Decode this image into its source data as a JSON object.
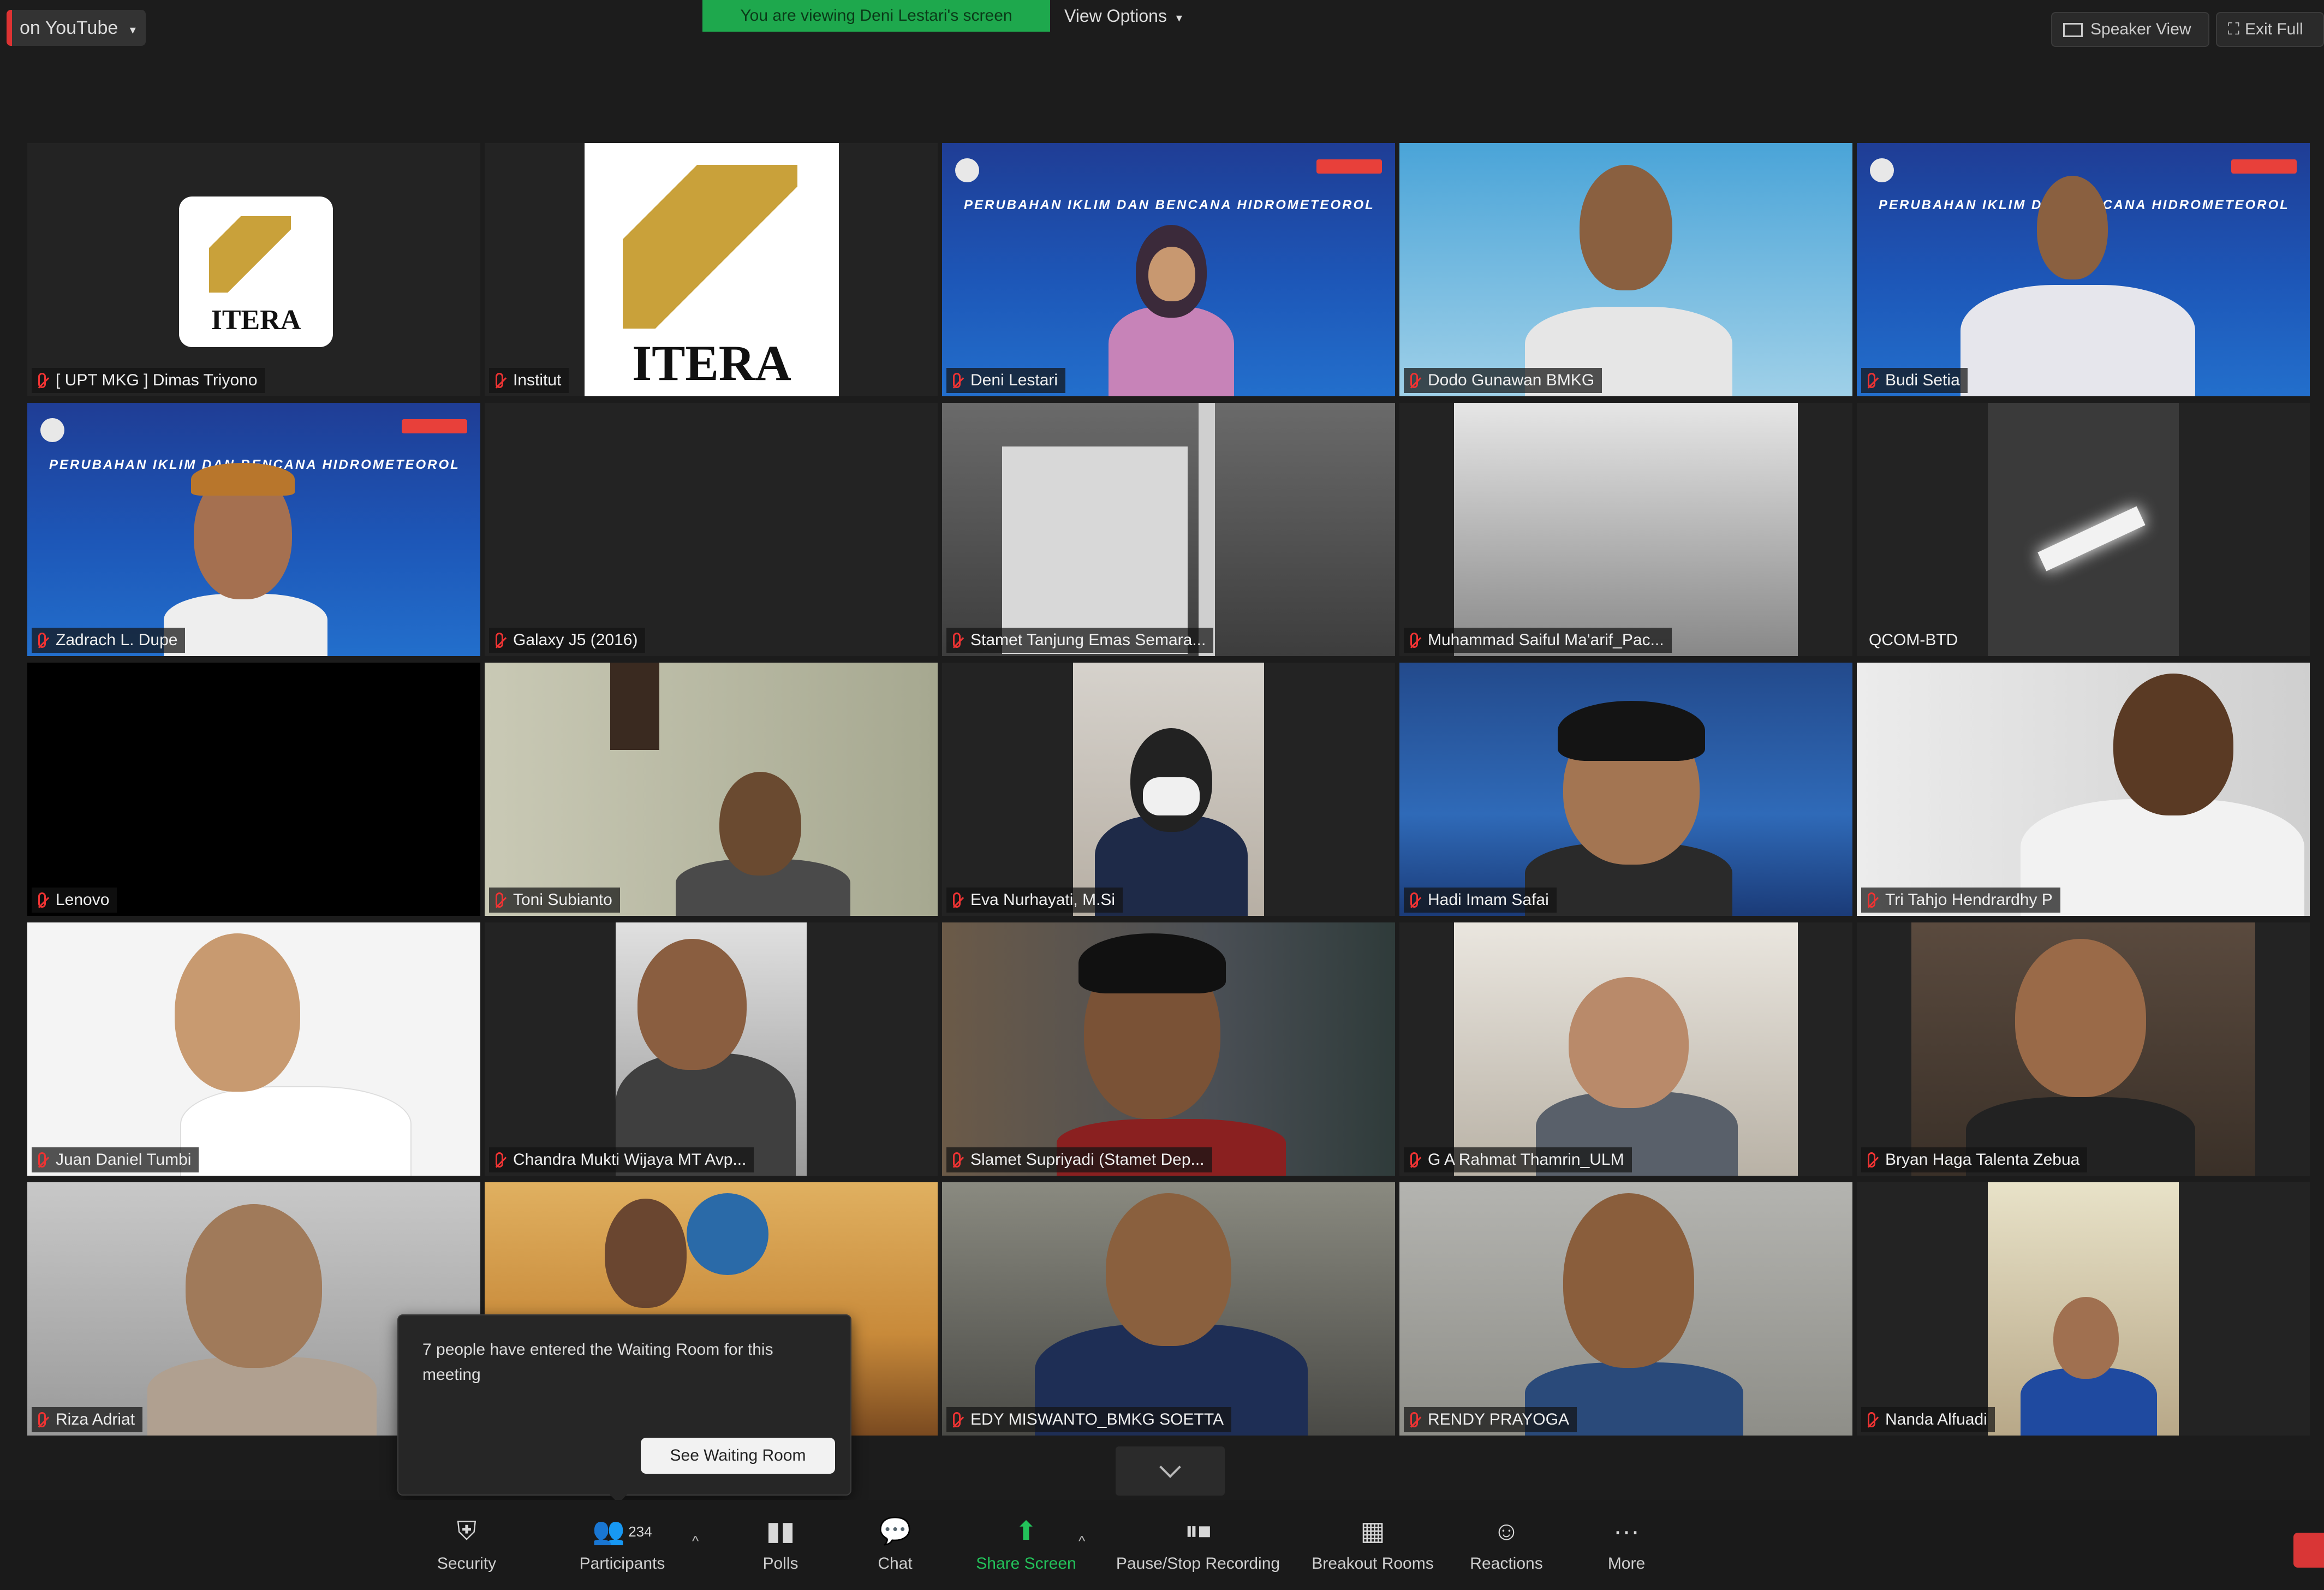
{
  "topbar": {
    "live_label": "on YouTube",
    "viewing_banner": "You are viewing Deni Lestari's screen",
    "view_options": "View Options",
    "speaker_view": "Speaker View",
    "exit_full": "Exit Full"
  },
  "participants": [
    {
      "name": "[ UPT MKG ] Dimas Triyono"
    },
    {
      "name": "Institut"
    },
    {
      "name": "Deni Lestari"
    },
    {
      "name": "Dodo Gunawan BMKG"
    },
    {
      "name": "Budi Setia"
    },
    {
      "name": "Zadrach L. Dupe"
    },
    {
      "name": "Galaxy J5 (2016)"
    },
    {
      "name": "Stamet Tanjung Emas Semara..."
    },
    {
      "name": "Muhammad Saiful Ma'arif_Pac..."
    },
    {
      "name": "QCOM-BTD"
    },
    {
      "name": "Lenovo"
    },
    {
      "name": "Toni Subianto"
    },
    {
      "name": "Eva Nurhayati, M.Si"
    },
    {
      "name": "Hadi Imam Safai"
    },
    {
      "name": "Tri Tahjo Hendrardhy P"
    },
    {
      "name": "Juan Daniel Tumbi"
    },
    {
      "name": "Chandra Mukti Wijaya MT Avp..."
    },
    {
      "name": "Slamet Supriyadi (Stamet Dep..."
    },
    {
      "name": "G A Rahmat Thamrin_ULM"
    },
    {
      "name": "Bryan Haga Talenta Zebua"
    },
    {
      "name": "Riza Adriat"
    },
    {
      "name": ""
    },
    {
      "name": "EDY MISWANTO_BMKG SOETTA"
    },
    {
      "name": "RENDY PRAYOGA"
    },
    {
      "name": "Nanda Alfuadi"
    }
  ],
  "slide_title": "PERUBAHAN IKLIM DAN BENCANA HIDROMETEOROLOGI",
  "itera_text": "ITERA",
  "waiting_toast": {
    "message": "7 people have entered the Waiting Room for this meeting",
    "button": "See Waiting Room"
  },
  "toolbar": {
    "security": "Security",
    "participants": "Participants",
    "participants_count": "234",
    "polls": "Polls",
    "chat": "Chat",
    "share_screen": "Share Screen",
    "recording": "Pause/Stop Recording",
    "breakout": "Breakout Rooms",
    "reactions": "Reactions",
    "more": "More"
  },
  "colors": {
    "background": "#1c1c1c",
    "share_green": "#23c25a",
    "active_speaker": "#d8d65a",
    "mute_red": "#e33333"
  }
}
